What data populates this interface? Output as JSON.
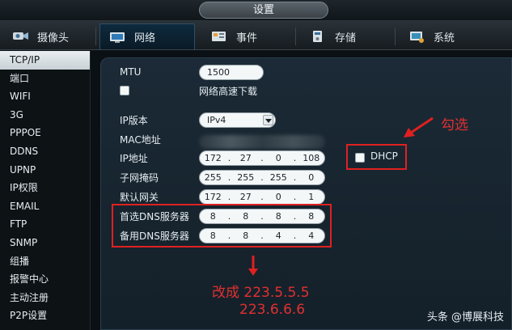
{
  "window": {
    "title": "设置"
  },
  "tabs": [
    {
      "label": "摄像头",
      "icon": "camera-icon"
    },
    {
      "label": "网络",
      "icon": "network-icon"
    },
    {
      "label": "事件",
      "icon": "event-icon"
    },
    {
      "label": "存储",
      "icon": "storage-icon"
    },
    {
      "label": "系统",
      "icon": "system-icon"
    }
  ],
  "sidebar": {
    "items": [
      "TCP/IP",
      "端口",
      "WIFI",
      "3G",
      "PPPOE",
      "DDNS",
      "UPNP",
      "IP权限",
      "EMAIL",
      "FTP",
      "SNMP",
      "组播",
      "报警中心",
      "主动注册",
      "P2P设置"
    ]
  },
  "form": {
    "mtu_label": "MTU",
    "mtu_value": "1500",
    "fast_download_label": "网络高速下载",
    "ip_version_label": "IP版本",
    "ip_version_value": "IPv4",
    "mac_label": "MAC地址",
    "ip_label": "IP地址",
    "ip": [
      "172",
      "27",
      "0",
      "108"
    ],
    "mask_label": "子网掩码",
    "mask": [
      "255",
      "255",
      "255",
      "0"
    ],
    "gateway_label": "默认网关",
    "gateway": [
      "172",
      "27",
      "0",
      "1"
    ],
    "dns1_label": "首选DNS服务器",
    "dns1": [
      "8",
      "8",
      "8",
      "8"
    ],
    "dns2_label": "备用DNS服务器",
    "dns2": [
      "8",
      "8",
      "4",
      "4"
    ],
    "dhcp_label": "DHCP"
  },
  "annotations": {
    "check_note": "勾选",
    "change_note_1": "改成 223.5.5.5",
    "change_note_2": "223.6.6.6",
    "color": "#e02020"
  },
  "watermark": "头条 @博展科技"
}
